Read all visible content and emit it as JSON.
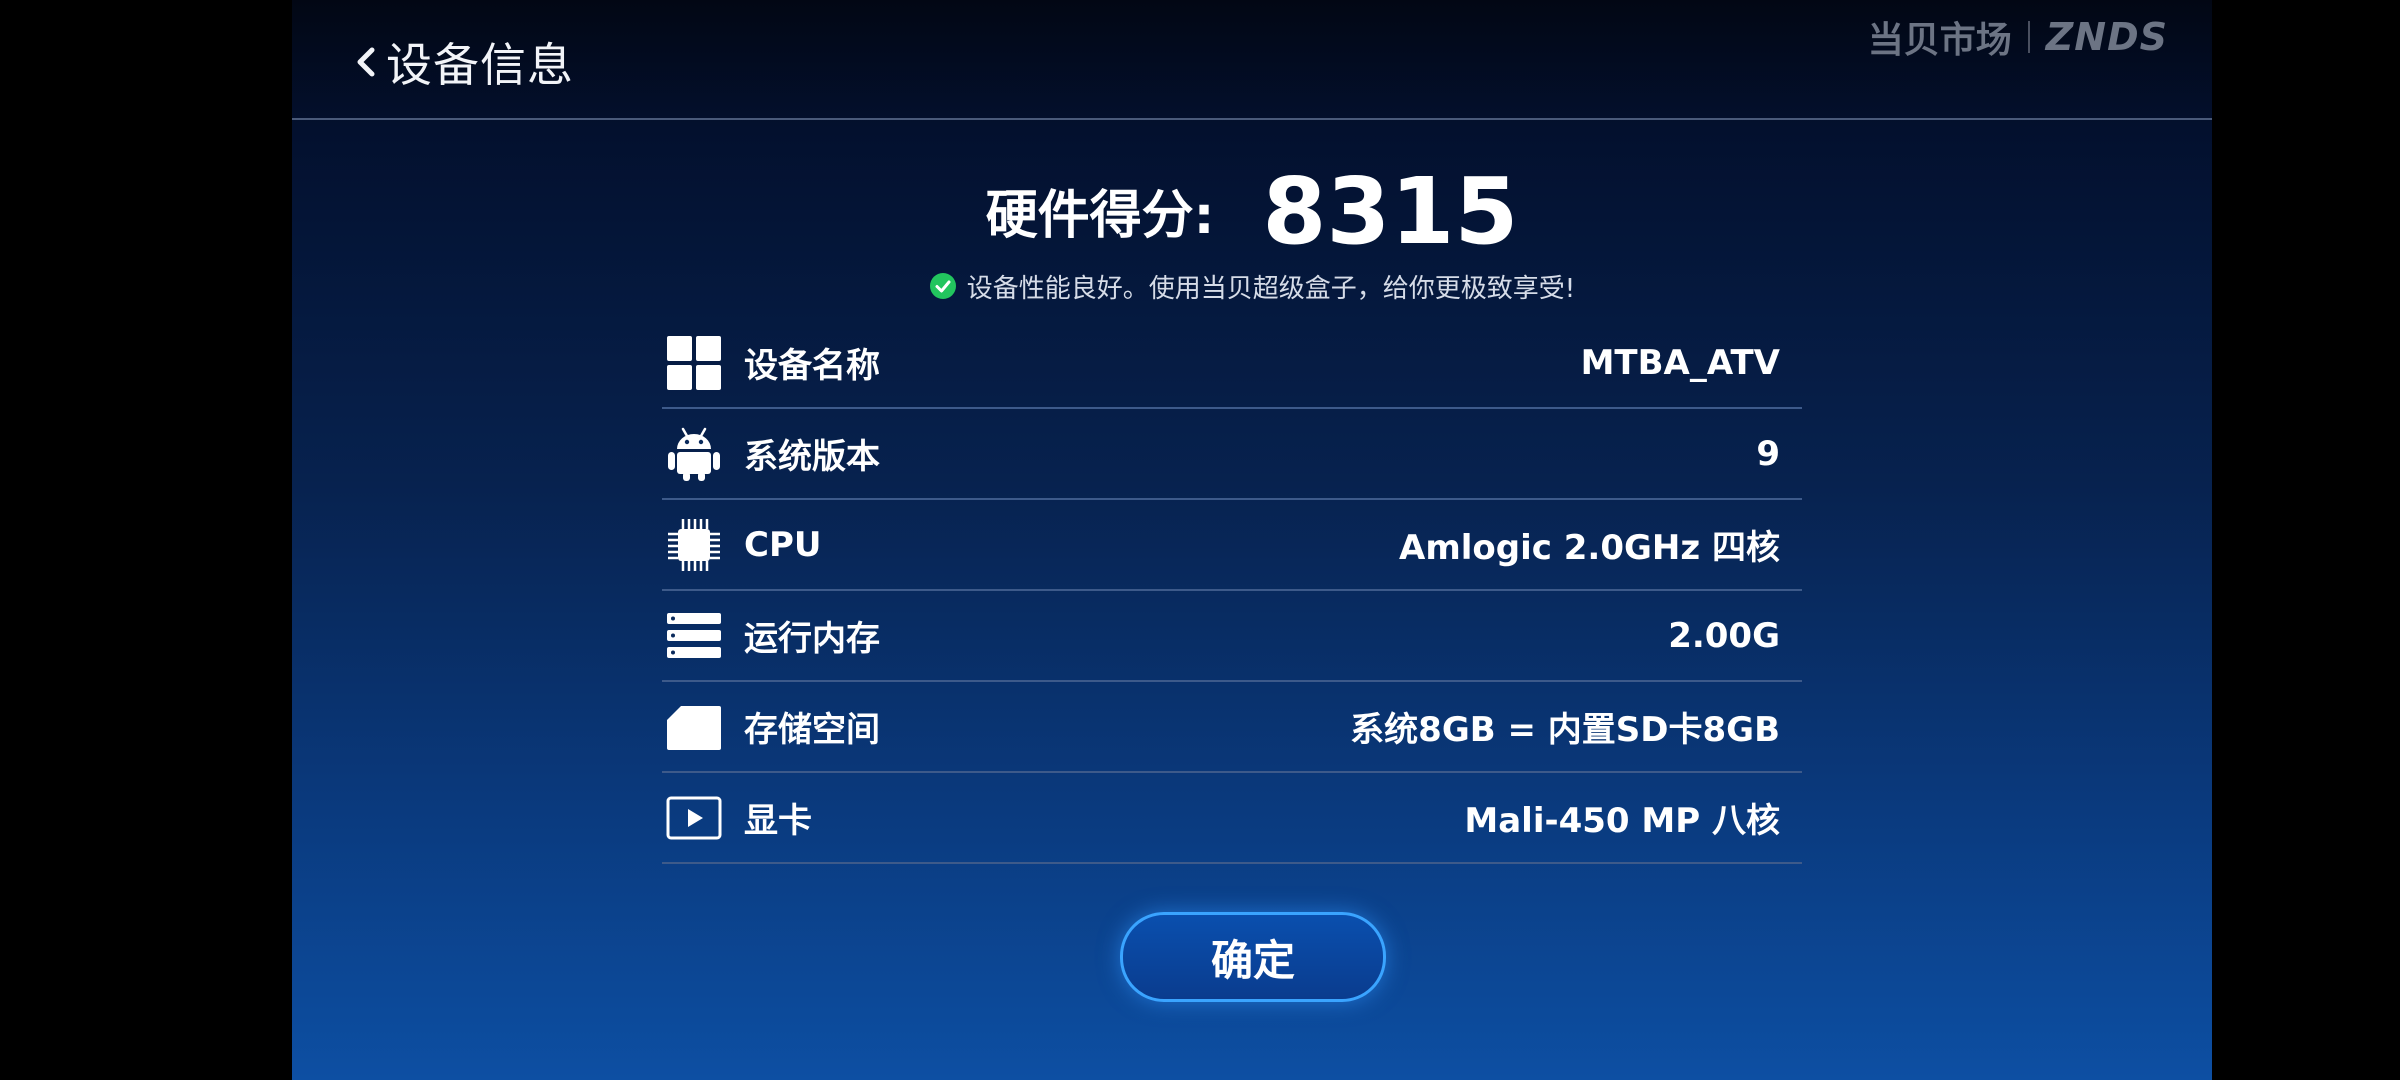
{
  "header": {
    "title": "设备信息",
    "brand_cn": "当贝市场",
    "brand_en": "ZNDS"
  },
  "score": {
    "label": "硬件得分:",
    "value": "8315"
  },
  "status_text": "设备性能良好。使用当贝超级盒子，给你更极致享受!",
  "rows": [
    {
      "icon": "grid-icon",
      "label": "设备名称",
      "value": "MTBA_ATV"
    },
    {
      "icon": "android-icon",
      "label": "系统版本",
      "value": "9"
    },
    {
      "icon": "cpu-chip-icon",
      "label": "CPU",
      "value": "Amlogic 2.0GHz 四核"
    },
    {
      "icon": "memory-icon",
      "label": "运行内存",
      "value": "2.00G"
    },
    {
      "icon": "sd-card-icon",
      "label": "存储空间",
      "value": "系统8GB = 内置SD卡8GB"
    },
    {
      "icon": "video-play-icon",
      "label": "显卡",
      "value": "Mali-450 MP 八核"
    }
  ],
  "ok_button": "确定",
  "colors": {
    "accent": "#3aa4ff",
    "status_ok": "#22c55e",
    "brand_gray": "#6c7484"
  }
}
